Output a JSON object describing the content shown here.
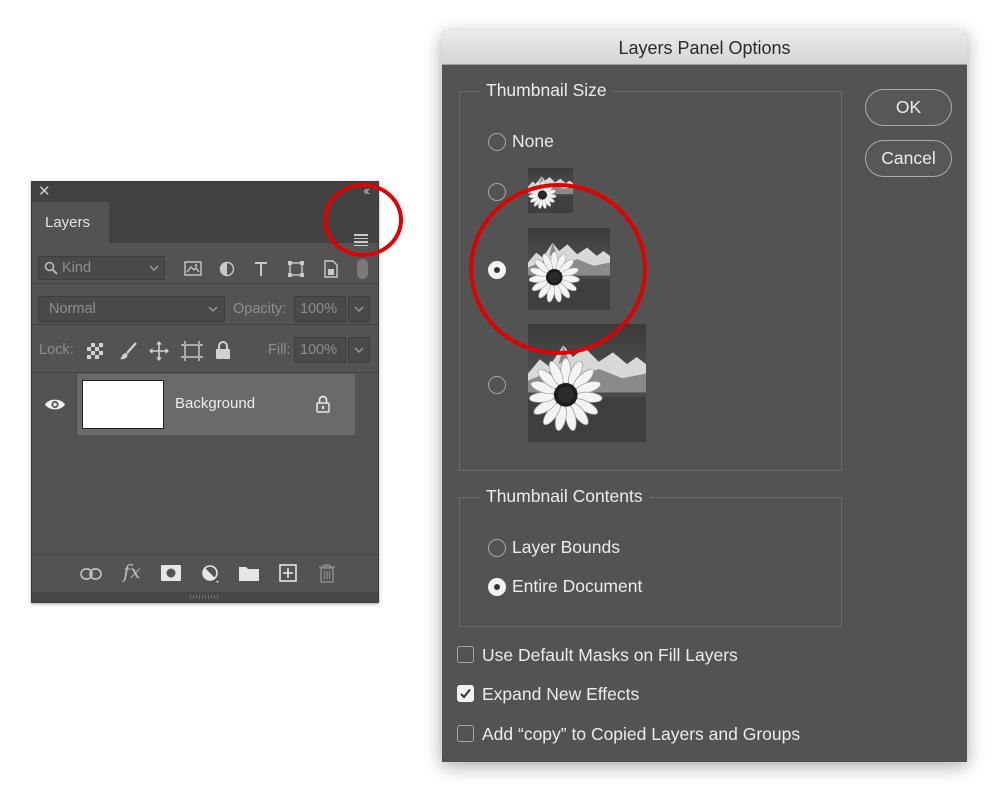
{
  "layers_panel": {
    "close_glyph": "✕",
    "collapse_glyph": "‹‹",
    "tab_label": "Layers",
    "filter_kind_label": "Kind",
    "blend_mode": "Normal",
    "opacity_label": "Opacity:",
    "opacity_value": "100%",
    "lock_label": "Lock:",
    "fill_label": "Fill:",
    "fill_value": "100%",
    "layers": [
      {
        "name": "Background",
        "visible": true,
        "locked": true
      }
    ],
    "footer_icons": [
      "link-icon",
      "fx-icon",
      "mask-icon",
      "adjustment-icon",
      "folder-icon",
      "new-layer-icon",
      "trash-icon"
    ],
    "fx_glyph": "fx"
  },
  "dialog": {
    "title": "Layers Panel Options",
    "thumbnail_size": {
      "legend": "Thumbnail Size",
      "options": [
        {
          "label": "None",
          "checked": false
        },
        {
          "label": "",
          "size": "small",
          "checked": false
        },
        {
          "label": "",
          "size": "medium",
          "checked": true
        },
        {
          "label": "",
          "size": "large",
          "checked": false
        }
      ]
    },
    "thumbnail_contents": {
      "legend": "Thumbnail Contents",
      "options": [
        {
          "label": "Layer Bounds",
          "checked": false
        },
        {
          "label": "Entire Document",
          "checked": true
        }
      ]
    },
    "checkboxes": [
      {
        "label": "Use Default Masks on Fill Layers",
        "checked": false
      },
      {
        "label": "Expand New Effects",
        "checked": true
      },
      {
        "label": "Add “copy” to Copied Layers and Groups",
        "checked": false
      }
    ],
    "ok_label": "OK",
    "cancel_label": "Cancel"
  },
  "colors": {
    "panel_bg": "#535353",
    "annotation_red": "#e00000",
    "dialog_title_bg": "#e0e0e0"
  }
}
